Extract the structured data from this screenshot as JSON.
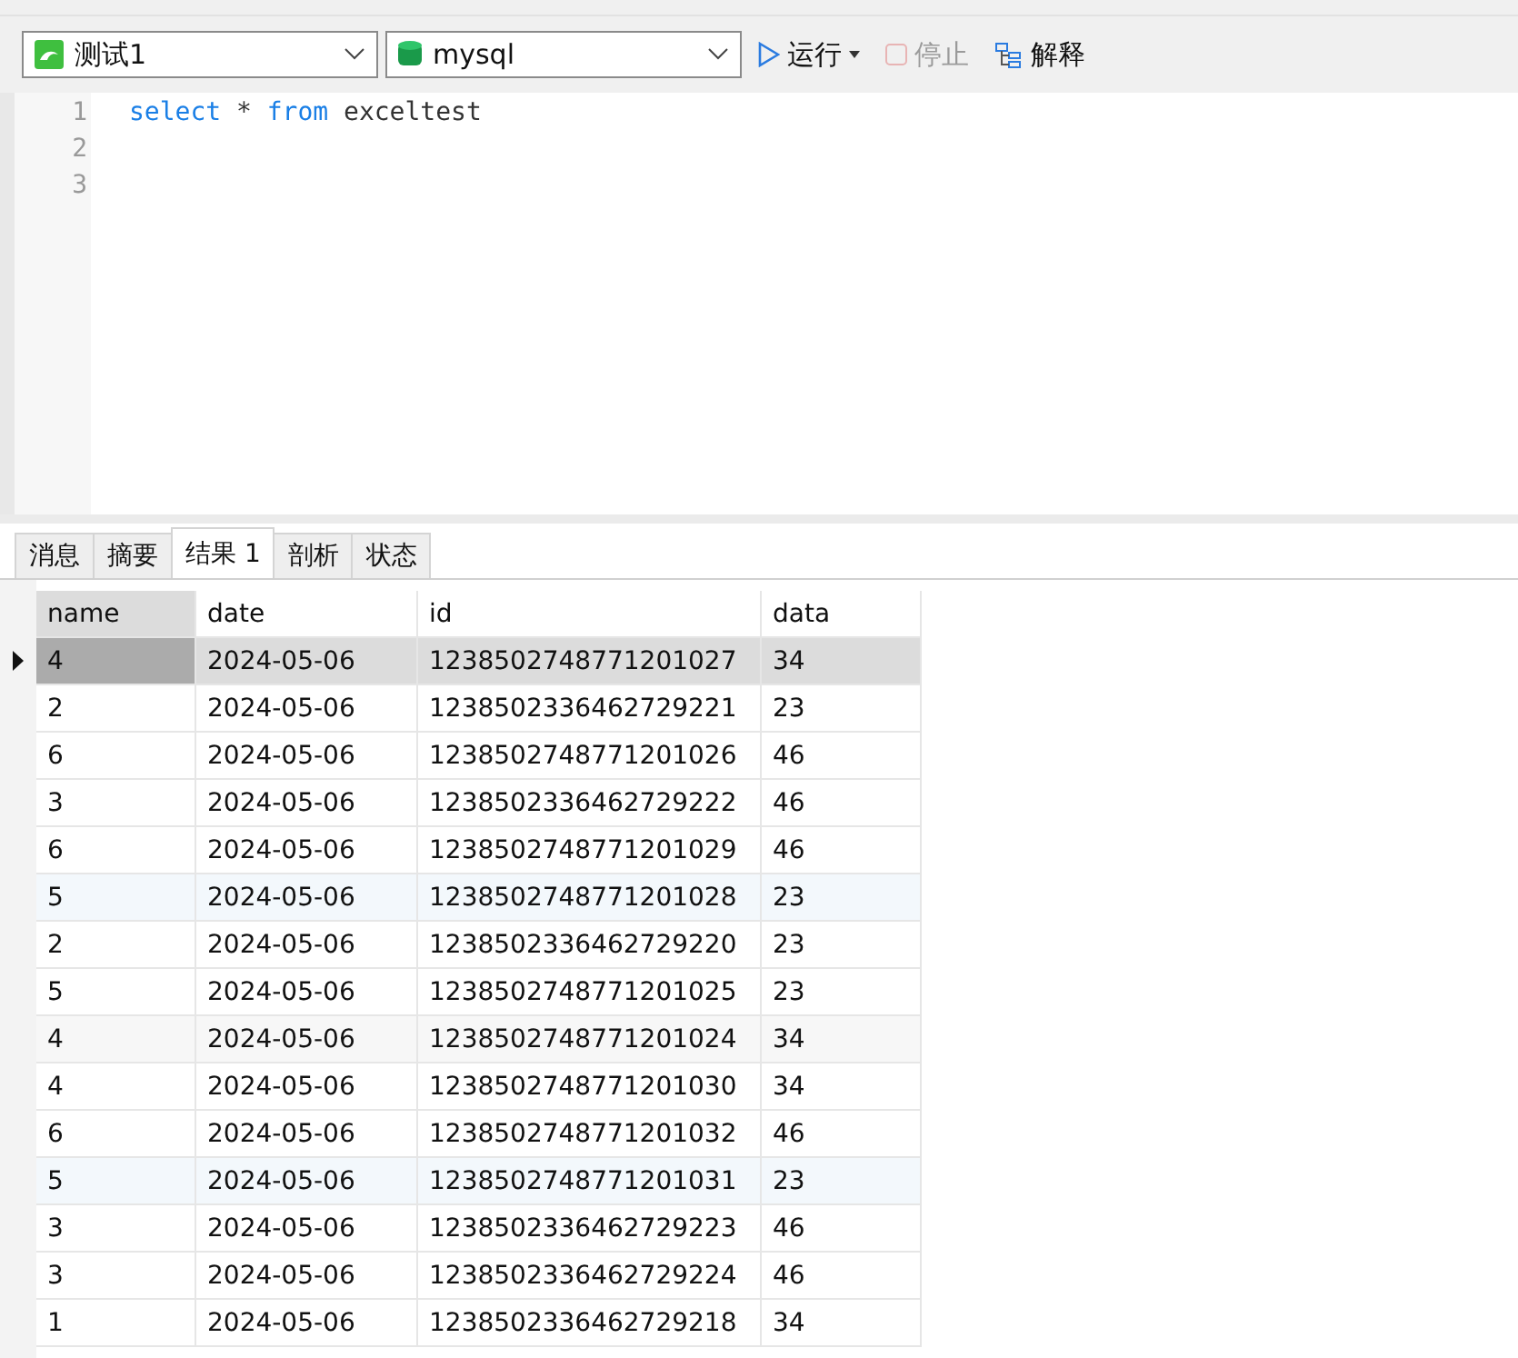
{
  "toolbar": {
    "connection": "测试1",
    "database": "mysql",
    "run": "运行",
    "stop": "停止",
    "stop_disabled": true,
    "explain": "解释"
  },
  "editor": {
    "lines": [
      {
        "number": "1",
        "tokens": [
          {
            "text": "select",
            "kind": "keyword"
          },
          {
            "text": " * ",
            "kind": "plain"
          },
          {
            "text": "from",
            "kind": "keyword"
          },
          {
            "text": " exceltest",
            "kind": "plain"
          }
        ]
      },
      {
        "number": "2"
      },
      {
        "number": "3"
      }
    ]
  },
  "tabs": [
    {
      "label": "消息",
      "selected": false
    },
    {
      "label": "摘要",
      "selected": false
    },
    {
      "label": "结果 1",
      "selected": true
    },
    {
      "label": "剖析",
      "selected": false
    },
    {
      "label": "状态",
      "selected": false
    }
  ],
  "table": {
    "columns": [
      "name",
      "date",
      "id",
      "data"
    ],
    "rows": [
      {
        "cells": [
          "4",
          "2024-05-06",
          "1238502748771201027",
          "34"
        ],
        "selected": true,
        "kind": "plain"
      },
      {
        "cells": [
          "2",
          "2024-05-06",
          "1238502336462729221",
          "23"
        ],
        "selected": false,
        "kind": "plain"
      },
      {
        "cells": [
          "6",
          "2024-05-06",
          "1238502748771201026",
          "46"
        ],
        "selected": false,
        "kind": "plain"
      },
      {
        "cells": [
          "3",
          "2024-05-06",
          "1238502336462729222",
          "46"
        ],
        "selected": false,
        "kind": "plain"
      },
      {
        "cells": [
          "6",
          "2024-05-06",
          "1238502748771201029",
          "46"
        ],
        "selected": false,
        "kind": "plain"
      },
      {
        "cells": [
          "5",
          "2024-05-06",
          "1238502748771201028",
          "23"
        ],
        "selected": false,
        "kind": "tinted"
      },
      {
        "cells": [
          "2",
          "2024-05-06",
          "1238502336462729220",
          "23"
        ],
        "selected": false,
        "kind": "plain"
      },
      {
        "cells": [
          "5",
          "2024-05-06",
          "1238502748771201025",
          "23"
        ],
        "selected": false,
        "kind": "plain"
      },
      {
        "cells": [
          "4",
          "2024-05-06",
          "1238502748771201024",
          "34"
        ],
        "selected": false,
        "kind": "shaded"
      },
      {
        "cells": [
          "4",
          "2024-05-06",
          "1238502748771201030",
          "34"
        ],
        "selected": false,
        "kind": "plain"
      },
      {
        "cells": [
          "6",
          "2024-05-06",
          "1238502748771201032",
          "46"
        ],
        "selected": false,
        "kind": "plain"
      },
      {
        "cells": [
          "5",
          "2024-05-06",
          "1238502748771201031",
          "23"
        ],
        "selected": false,
        "kind": "tinted"
      },
      {
        "cells": [
          "3",
          "2024-05-06",
          "1238502336462729223",
          "46"
        ],
        "selected": false,
        "kind": "plain"
      },
      {
        "cells": [
          "3",
          "2024-05-06",
          "1238502336462729224",
          "46"
        ],
        "selected": false,
        "kind": "plain"
      },
      {
        "cells": [
          "1",
          "2024-05-06",
          "1238502336462729218",
          "34"
        ],
        "selected": false,
        "kind": "plain"
      }
    ]
  }
}
